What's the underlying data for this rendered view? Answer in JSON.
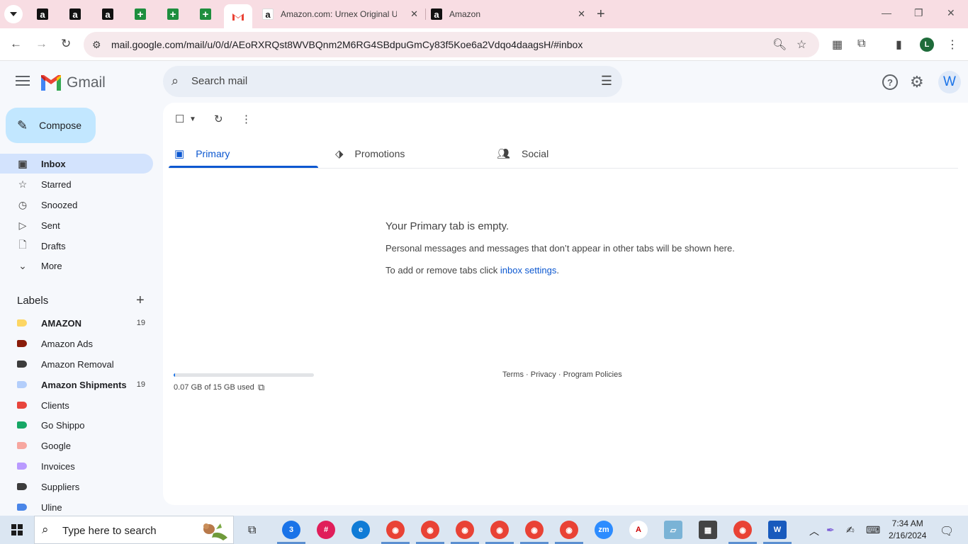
{
  "browser": {
    "tabs": [
      {
        "title": "Amazon.com: Urnex Original Ur",
        "favicon": "amazon-icon"
      },
      {
        "title": "Amazon",
        "favicon": "amazon-icon"
      }
    ],
    "url": "mail.google.com/mail/u/0/d/AEoRXRQst8WVBQnm2M6RG4SBdpuGmCy83f5Koe6a2Vdqo4daagsH/#inbox",
    "profile_initial": "L"
  },
  "gmail": {
    "logo_text": "Gmail",
    "search_placeholder": "Search mail",
    "avatar_initial": "W",
    "compose_label": "Compose",
    "nav": [
      {
        "label": "Inbox",
        "icon": "inbox-icon"
      },
      {
        "label": "Starred",
        "icon": "star-icon"
      },
      {
        "label": "Snoozed",
        "icon": "clock-icon"
      },
      {
        "label": "Sent",
        "icon": "send-icon"
      },
      {
        "label": "Drafts",
        "icon": "draft-icon"
      },
      {
        "label": "More",
        "icon": "chevron-down-icon"
      }
    ],
    "labels_heading": "Labels",
    "labels": [
      {
        "name": "AMAZON",
        "count": "19",
        "color": "#fdd663",
        "bold": true
      },
      {
        "name": "Amazon Ads",
        "count": "",
        "color": "#8a1c0a",
        "bold": false
      },
      {
        "name": "Amazon Removal",
        "count": "",
        "color": "#3c3c3c",
        "bold": false
      },
      {
        "name": "Amazon Shipments",
        "count": "19",
        "color": "#b3cefb",
        "bold": true
      },
      {
        "name": "Clients",
        "count": "",
        "color": "#e8453c",
        "bold": false
      },
      {
        "name": "Go Shippo",
        "count": "",
        "color": "#16a765",
        "bold": false
      },
      {
        "name": "Google",
        "count": "",
        "color": "#f7a7a0",
        "bold": false
      },
      {
        "name": "Invoices",
        "count": "",
        "color": "#b99aff",
        "bold": false
      },
      {
        "name": "Suppliers",
        "count": "",
        "color": "#3c3c3c",
        "bold": false
      },
      {
        "name": "Uline",
        "count": "",
        "color": "#4a86e8",
        "bold": false
      }
    ],
    "category_tabs": [
      {
        "label": "Primary",
        "icon": "inbox-icon"
      },
      {
        "label": "Promotions",
        "icon": "tag-icon"
      },
      {
        "label": "Social",
        "icon": "people-icon"
      }
    ],
    "empty": {
      "heading": "Your Primary tab is empty.",
      "line1": "Personal messages and messages that don’t appear in other tabs will be shown here.",
      "line2_prefix": "To add or remove tabs click ",
      "line2_link": "inbox settings",
      "line2_suffix": "."
    },
    "storage": {
      "text": "0.07 GB of 15 GB used",
      "fraction": 0.005
    },
    "footer": {
      "terms": "Terms",
      "privacy": "Privacy",
      "policies": "Program Policies",
      "sep": " · "
    }
  },
  "taskbar": {
    "search_placeholder": "Type here to search",
    "mail_badge": "3",
    "time": "7:34 AM",
    "date": "2/16/2024"
  },
  "colors": {
    "accent": "#0b57d0",
    "compose_bg": "#c2e7ff",
    "active_nav": "#d3e3fd",
    "tabstrip": "#f8dde3"
  }
}
